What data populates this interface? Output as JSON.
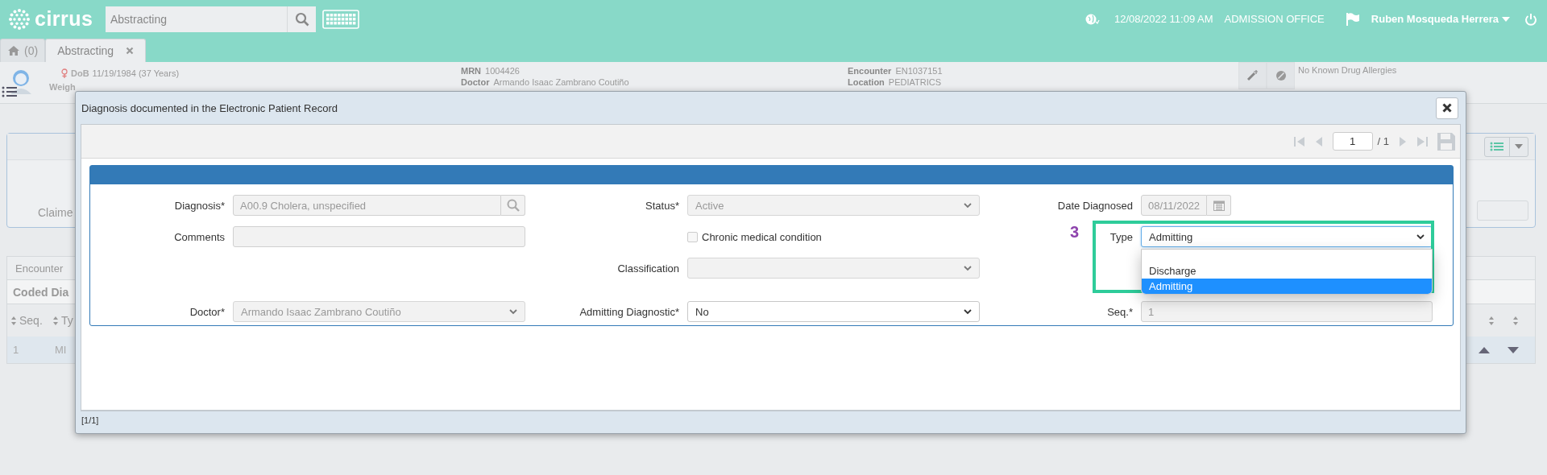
{
  "header": {
    "logo": "cirrus",
    "search": {
      "value": "Abstracting"
    },
    "datetime": "12/08/2022 11:09 AM",
    "office": "ADMISSION OFFICE",
    "user": "Ruben Mosqueda Herrera"
  },
  "tabs": [
    {
      "kind": "home",
      "label": "(0)",
      "selected": false
    },
    {
      "kind": "page",
      "label": "Abstracting",
      "selected": true
    }
  ],
  "patient": {
    "dob_label": "DoB",
    "dob": "11/19/1984 (37 Years)",
    "weight_label": "Weigh",
    "groups": [
      [
        {
          "label": "MRN",
          "value": "1004426"
        },
        {
          "label": "Doctor",
          "value": "Armando Isaac Zambrano Coutiño"
        }
      ],
      [
        {
          "label": "Encounter",
          "value": "EN1037151"
        },
        {
          "label": "Location",
          "value": "PEDIATRICS"
        }
      ]
    ],
    "allergies": "No Known Drug Allergies"
  },
  "background": {
    "claim_label": "Claime",
    "tab": "Encounter",
    "section": "Coded Dia",
    "columns": [
      "Seq.",
      "Ty"
    ],
    "row": [
      "1",
      "MI"
    ]
  },
  "dialog": {
    "title": "Diagnosis documented in the Electronic Patient Record",
    "pager": {
      "page": "1",
      "total": "/ 1"
    },
    "rows": [
      {
        "left": {
          "kind": "search",
          "label": "Diagnosis*",
          "value": "A00.9 Cholera, unspecified",
          "disabled": true
        },
        "middle": {
          "kind": "select",
          "label": "Status*",
          "value": "Active",
          "disabled": true
        },
        "right": {
          "kind": "date",
          "label": "Date Diagnosed",
          "value": "08/11/2022",
          "disabled": true
        }
      },
      {
        "left": {
          "kind": "textarea",
          "label": "Comments",
          "disabled": true
        },
        "middle": {
          "kind": "checkbox",
          "label": "Chronic medical condition",
          "checked": false
        },
        "right": {
          "kind": "select",
          "label": "Type",
          "value": "Admitting",
          "disabled": false,
          "expanded": true,
          "annotation": "3",
          "options": [
            {
              "label": "Discharge",
              "selected": false
            },
            {
              "label": "Admitting",
              "selected": true
            }
          ]
        }
      },
      {
        "middle": {
          "kind": "select",
          "label": "Classification",
          "disabled": true
        }
      },
      {
        "left": {
          "kind": "select",
          "label": "Doctor*",
          "value": "Armando Isaac Zambrano Coutiño",
          "disabled": true
        },
        "middle": {
          "kind": "select",
          "label": "Admitting Diagnostic*",
          "value": "No",
          "disabled": false
        },
        "right": {
          "kind": "text",
          "label": "Seq.*",
          "value": "1",
          "disabled": true
        }
      }
    ],
    "footer": "[1/1]"
  }
}
